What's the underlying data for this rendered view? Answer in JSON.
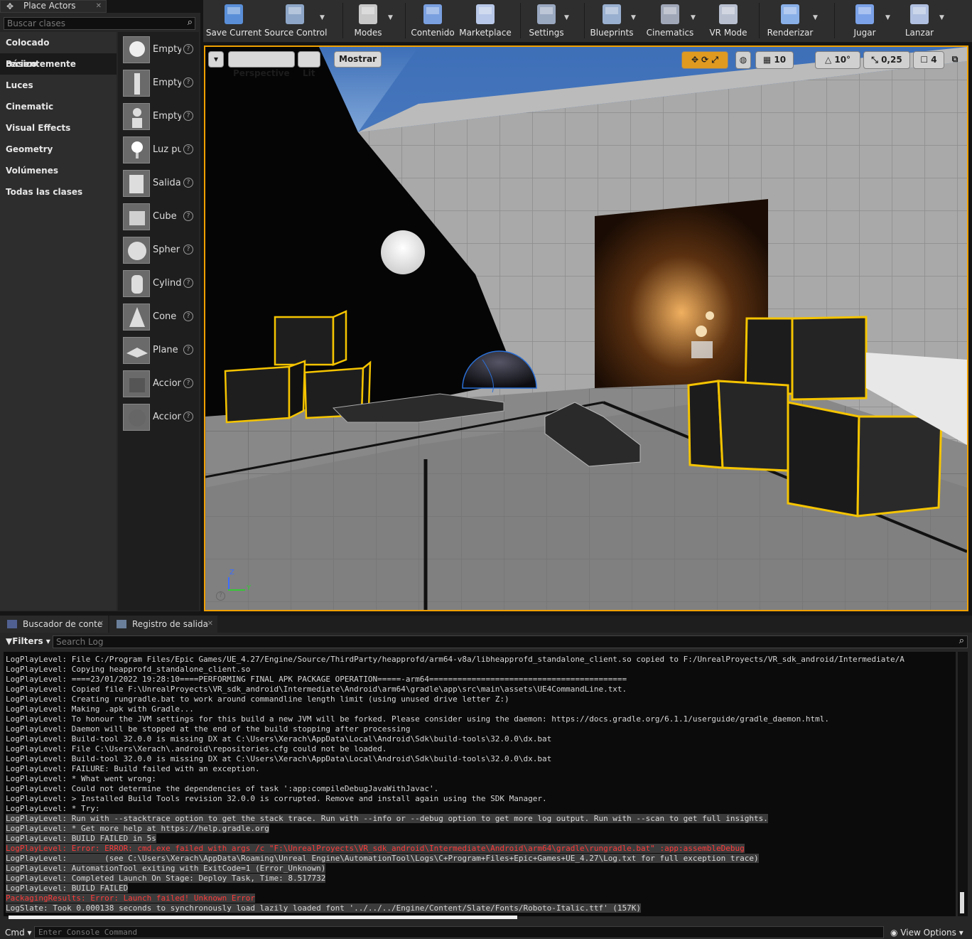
{
  "place_actors": {
    "title": "Place Actors",
    "search_placeholder": "Buscar clases",
    "categories": [
      {
        "label": "Colocado recientemente",
        "selected": false
      },
      {
        "label": "Básico",
        "selected": true
      },
      {
        "label": "Luces",
        "selected": false
      },
      {
        "label": "Cinematic",
        "selected": false
      },
      {
        "label": "Visual Effects",
        "selected": false
      },
      {
        "label": "Geometry",
        "selected": false
      },
      {
        "label": "Volúmenes",
        "selected": false
      },
      {
        "label": "Todas las clases",
        "selected": false
      }
    ],
    "actors": [
      {
        "label": "Empty",
        "icon": "empty-actor-icon"
      },
      {
        "label": "Empty",
        "icon": "empty-character-icon"
      },
      {
        "label": "Empty",
        "icon": "empty-pawn-icon"
      },
      {
        "label": "Luz pu",
        "icon": "point-light-icon"
      },
      {
        "label": "Salida",
        "icon": "player-start-icon"
      },
      {
        "label": "Cube",
        "icon": "cube-icon"
      },
      {
        "label": "Spher",
        "icon": "sphere-icon"
      },
      {
        "label": "Cylind",
        "icon": "cylinder-icon"
      },
      {
        "label": "Cone",
        "icon": "cone-icon"
      },
      {
        "label": "Plane",
        "icon": "plane-icon"
      },
      {
        "label": "Accion",
        "icon": "box-trigger-icon"
      },
      {
        "label": "Accion",
        "icon": "sphere-trigger-icon"
      }
    ],
    "help_glyph": "?"
  },
  "toolbar": {
    "buttons": [
      {
        "label": "Save Current",
        "icon": "save-icon",
        "dropdown": false
      },
      {
        "label": "Source Control",
        "icon": "source-control-icon",
        "dropdown": true
      },
      {
        "label": "Modes",
        "icon": "modes-icon",
        "dropdown": true
      },
      {
        "label": "Contenido",
        "icon": "content-icon",
        "dropdown": false
      },
      {
        "label": "Marketplace",
        "icon": "marketplace-icon",
        "dropdown": false
      },
      {
        "label": "Settings",
        "icon": "settings-icon",
        "dropdown": true
      },
      {
        "label": "Blueprints",
        "icon": "blueprints-icon",
        "dropdown": true
      },
      {
        "label": "Cinematics",
        "icon": "cinematics-icon",
        "dropdown": true
      },
      {
        "label": "VR Mode",
        "icon": "vr-mode-icon",
        "dropdown": false
      },
      {
        "label": "Renderizar",
        "icon": "build-icon",
        "dropdown": true
      },
      {
        "label": "Jugar",
        "icon": "play-icon",
        "dropdown": true
      },
      {
        "label": "Lanzar",
        "icon": "launch-icon",
        "dropdown": true
      }
    ]
  },
  "viewport": {
    "perspective_label": "Perspective",
    "lit_label": "Lit",
    "show_label": "Mostrar",
    "grid_snap": "10",
    "rotation_snap": "10°",
    "scale_snap": "0,25",
    "camera_speed": "4",
    "axis_z": "Z",
    "axis_y": "Y",
    "accent": "#f0a000"
  },
  "bottom": {
    "tab_content_browser": "Buscador de conte",
    "tab_output_log": "Registro de salida",
    "filters_label": "Filters",
    "search_log_placeholder": "Search Log",
    "cmd_label": "Cmd",
    "console_placeholder": "Enter Console Command",
    "view_options": "View Options"
  },
  "log_lines": [
    {
      "text": "LogPlayLevel: File C:/Program Files/Epic Games/UE_4.27/Engine/Source/ThirdParty/heapprofd/arm64-v8a/libheapprofd_standalone_client.so copied to F:/UnrealProyects/VR_sdk_android/Intermediate/A",
      "style": "normal"
    },
    {
      "text": "LogPlayLevel: Copying heapprofd_standalone_client.so",
      "style": "normal"
    },
    {
      "text": "LogPlayLevel: ====23/01/2022 19:28:10====PERFORMING FINAL APK PACKAGE OPERATION=====-arm64==========================================",
      "style": "normal"
    },
    {
      "text": "LogPlayLevel: Copied file F:\\UnrealProyects\\VR_sdk_android\\Intermediate\\Android\\arm64\\gradle\\app\\src\\main\\assets\\UE4CommandLine.txt.",
      "style": "normal"
    },
    {
      "text": "LogPlayLevel: Creating rungradle.bat to work around commandline length limit (using unused drive letter Z:)",
      "style": "normal"
    },
    {
      "text": "LogPlayLevel: Making .apk with Gradle...",
      "style": "normal"
    },
    {
      "text": "LogPlayLevel: To honour the JVM settings for this build a new JVM will be forked. Please consider using the daemon: https://docs.gradle.org/6.1.1/userguide/gradle_daemon.html.",
      "style": "normal"
    },
    {
      "text": "LogPlayLevel: Daemon will be stopped at the end of the build stopping after processing",
      "style": "normal"
    },
    {
      "text": "LogPlayLevel: Build-tool 32.0.0 is missing DX at C:\\Users\\Xerach\\AppData\\Local\\Android\\Sdk\\build-tools\\32.0.0\\dx.bat",
      "style": "normal"
    },
    {
      "text": "LogPlayLevel: File C:\\Users\\Xerach\\.android\\repositories.cfg could not be loaded.",
      "style": "normal"
    },
    {
      "text": "LogPlayLevel: Build-tool 32.0.0 is missing DX at C:\\Users\\Xerach\\AppData\\Local\\Android\\Sdk\\build-tools\\32.0.0\\dx.bat",
      "style": "normal"
    },
    {
      "text": "LogPlayLevel: FAILURE: Build failed with an exception.",
      "style": "normal"
    },
    {
      "text": "LogPlayLevel: * What went wrong:",
      "style": "normal"
    },
    {
      "text": "LogPlayLevel: Could not determine the dependencies of task ':app:compileDebugJavaWithJavac'.",
      "style": "normal"
    },
    {
      "text": "LogPlayLevel: > Installed Build Tools revision 32.0.0 is corrupted. Remove and install again using the SDK Manager.",
      "style": "normal"
    },
    {
      "text": "LogPlayLevel: * Try:",
      "style": "normal"
    },
    {
      "text": "LogPlayLevel: Run with --stacktrace option to get the stack trace. Run with --info or --debug option to get more log output. Run with --scan to get full insights.",
      "style": "hl"
    },
    {
      "text": "LogPlayLevel: * Get more help at https://help.gradle.org",
      "style": "hl"
    },
    {
      "text": "LogPlayLevel: BUILD FAILED in 5s",
      "style": "hl"
    },
    {
      "text": "LogPlayLevel: Error: ERROR: cmd.exe failed with args /c \"F:\\UnrealProyects\\VR_sdk_android\\Intermediate\\Android\\arm64\\gradle\\rungradle.bat\" :app:assembleDebug",
      "style": "err"
    },
    {
      "text": "LogPlayLevel:        (see C:\\Users\\Xerach\\AppData\\Roaming\\Unreal Engine\\AutomationTool\\Logs\\C+Program+Files+Epic+Games+UE_4.27\\Log.txt for full exception trace)",
      "style": "hl"
    },
    {
      "text": "LogPlayLevel: AutomationTool exiting with ExitCode=1 (Error_Unknown)",
      "style": "hl"
    },
    {
      "text": "LogPlayLevel: Completed Launch On Stage: Deploy Task, Time: 8.517732",
      "style": "hl"
    },
    {
      "text": "LogPlayLevel: BUILD FAILED",
      "style": "hl"
    },
    {
      "text": "PackagingResults: Error: Launch failed! Unknown Error",
      "style": "err"
    },
    {
      "text": "LogSlate: Took 0.000138 seconds to synchronously load lazily loaded font '../../../Engine/Content/Slate/Fonts/Roboto-Italic.ttf' (157K)",
      "style": "hl"
    }
  ]
}
